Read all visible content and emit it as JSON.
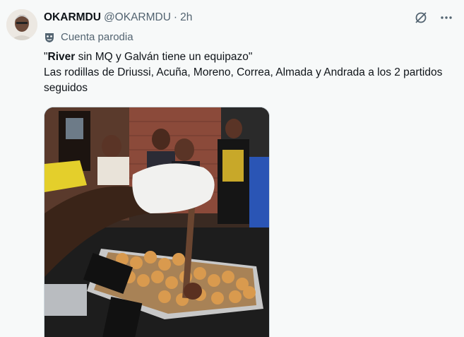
{
  "tweet": {
    "display_name": "OKARMDU",
    "handle": "@OKARMDU",
    "separator": "·",
    "time": "2h",
    "parody_label": "Cuenta parodia",
    "text_quote_open": "\"",
    "text_bold": "River",
    "text_rest": " sin MQ y Galván tiene un equipazo\"",
    "text_line2": "Las rodillas de Driussi, Acuña, Moreno, Correa, Almada y Andrada a los 2 partidos seguidos"
  },
  "icons": {
    "grok": "grok-icon",
    "more": "more-icon",
    "parody": "parody-mask-icon"
  },
  "colors": {
    "text_primary": "#0f1419",
    "text_secondary": "#536471",
    "background": "#f7f9f9"
  }
}
